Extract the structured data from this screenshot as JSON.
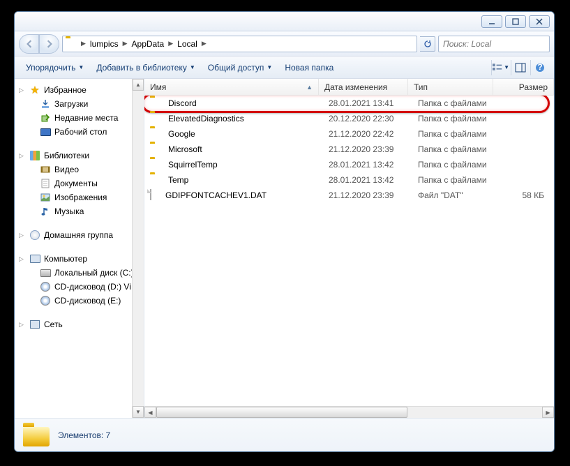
{
  "breadcrumbs": [
    "lumpics",
    "AppData",
    "Local"
  ],
  "search": {
    "placeholder": "Поиск: Local"
  },
  "toolbar": {
    "organize": "Упорядочить",
    "add_library": "Добавить в библиотеку",
    "share": "Общий доступ",
    "new_folder": "Новая папка"
  },
  "columns": {
    "name": "Имя",
    "date": "Дата изменения",
    "type": "Тип",
    "size": "Размер"
  },
  "rows": [
    {
      "name": "Discord",
      "date": "28.01.2021 13:41",
      "type": "Папка с файлами",
      "size": "",
      "icon": "folder",
      "highlight": true
    },
    {
      "name": "ElevatedDiagnostics",
      "date": "20.12.2020 22:30",
      "type": "Папка с файлами",
      "size": "",
      "icon": "folder"
    },
    {
      "name": "Google",
      "date": "21.12.2020 22:42",
      "type": "Папка с файлами",
      "size": "",
      "icon": "folder"
    },
    {
      "name": "Microsoft",
      "date": "21.12.2020 23:39",
      "type": "Папка с файлами",
      "size": "",
      "icon": "folder"
    },
    {
      "name": "SquirrelTemp",
      "date": "28.01.2021 13:42",
      "type": "Папка с файлами",
      "size": "",
      "icon": "folder"
    },
    {
      "name": "Temp",
      "date": "28.01.2021 13:42",
      "type": "Папка с файлами",
      "size": "",
      "icon": "folder"
    },
    {
      "name": "GDIPFONTCACHEV1.DAT",
      "date": "21.12.2020 23:39",
      "type": "Файл \"DAT\"",
      "size": "58 КБ",
      "icon": "file"
    }
  ],
  "sidebar": {
    "favorites": {
      "label": "Избранное",
      "items": [
        "Загрузки",
        "Недавние места",
        "Рабочий стол"
      ]
    },
    "libraries": {
      "label": "Библиотеки",
      "items": [
        "Видео",
        "Документы",
        "Изображения",
        "Музыка"
      ]
    },
    "homegroup": {
      "label": "Домашняя группа"
    },
    "computer": {
      "label": "Компьютер",
      "items": [
        "Локальный диск (C:)",
        "CD-дисковод (D:) Vi",
        "CD-дисковод (E:)"
      ]
    },
    "network": {
      "label": "Сеть"
    }
  },
  "status": {
    "count_label": "Элементов: 7"
  }
}
